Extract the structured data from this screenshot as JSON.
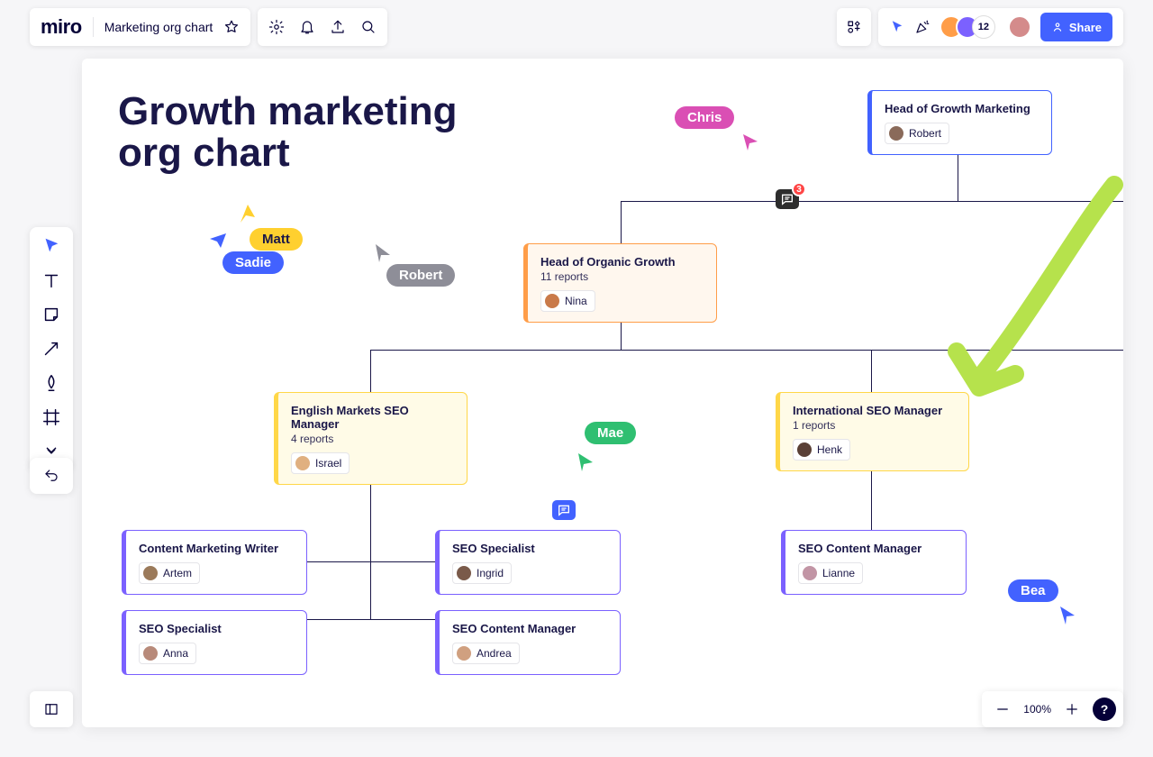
{
  "header": {
    "logo": "miro",
    "board_title": "Marketing org chart",
    "collab_count": "12",
    "share_label": "Share"
  },
  "heading": "Growth marketing\norg chart",
  "nodes": {
    "head_growth": {
      "title": "Head of Growth Marketing",
      "person": "Robert"
    },
    "head_organic": {
      "title": "Head of Organic Growth",
      "sub": "11 reports",
      "person": "Nina"
    },
    "eng_seo_mgr": {
      "title": "English Markets SEO Manager",
      "sub": "4 reports",
      "person": "Israel"
    },
    "intl_seo_mgr": {
      "title": "International SEO Manager",
      "sub": "1 reports",
      "person": "Henk"
    },
    "content_writer": {
      "title": "Content Marketing Writer",
      "person": "Artem"
    },
    "seo_spec_1": {
      "title": "SEO Specialist",
      "person": "Ingrid"
    },
    "seo_spec_2": {
      "title": "SEO Specialist",
      "person": "Anna"
    },
    "seo_cm_1": {
      "title": "SEO Content Manager",
      "person": "Andrea"
    },
    "seo_cm_2": {
      "title": "SEO Content Manager",
      "person": "Lianne"
    }
  },
  "cursors": {
    "chris": "Chris",
    "matt": "Matt",
    "sadie": "Sadie",
    "robert": "Robert",
    "mae": "Mae",
    "bea": "Bea"
  },
  "comments": {
    "badge": "3"
  },
  "zoom": {
    "label": "100%"
  },
  "help": "?"
}
